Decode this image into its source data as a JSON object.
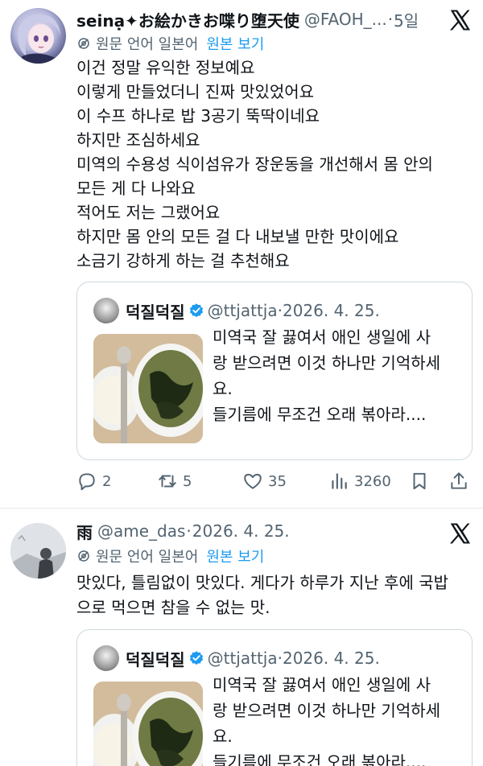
{
  "tweets": [
    {
      "name": "seinạ✦お絵かきお喋り堕天使",
      "handle": "@FAOH_...",
      "separator": "·",
      "time": "5일",
      "translate_label": "원문 언어 일본어",
      "translate_link": "원본 보기",
      "body": [
        "이건 정말 유익한 정보예요",
        "이렇게 만들었더니 진짜 맛있었어요",
        "이 수프 하나로 밥 3공기 뚝딱이네요",
        "하지만 조심하세요",
        "미역의 수용성 식이섬유가 장운동을 개선해서 몸 안의",
        "모든 게 다 나와요",
        "적어도 저는 그랬어요",
        "하지만 몸 안의 모든 걸 다 내보낼 만한 맛이에요",
        "소금기 강하게 하는 걸 추천해요"
      ],
      "quote": {
        "name": "덕질덕질",
        "handle": "@ttjattja",
        "separator": "·",
        "time": "2026. 4. 25.",
        "text": [
          "미역국 잘 끓여서 애인 생일에 사",
          "랑 받으려면 이것 하나만 기억하세",
          "요.",
          "들기름에 무조건 오래 볶아라...."
        ]
      },
      "actions": {
        "reply_count": "2",
        "retweet_count": "5",
        "like_count": "35",
        "view_count": "3260"
      }
    },
    {
      "name": "雨",
      "handle": "@ame_das",
      "separator": "·",
      "time": "2026. 4. 25.",
      "translate_label": "원문 언어 일본어",
      "translate_link": "원본 보기",
      "body": [
        "맛있다, 틀림없이 맛있다. 게다가 하루가 지난 후에 국밥",
        "으로 먹으면 참을 수 없는 맛."
      ],
      "quote": {
        "name": "덕질덕질",
        "handle": "@ttjattja",
        "separator": "·",
        "time": "2026. 4. 25.",
        "text": [
          "미역국 잘 끓여서 애인 생일에 사",
          "랑 받으려면 이것 하나만 기억하세",
          "요.",
          "들기름에 무조건 오래 볶아라...."
        ]
      }
    }
  ],
  "icons": {
    "platform_logo": "x-logo-icon",
    "translate": "gear-icon",
    "verified": "verified-badge-icon",
    "reply": "reply-icon",
    "retweet": "retweet-icon",
    "like": "heart-icon",
    "views": "views-icon",
    "bookmark": "bookmark-icon",
    "share": "share-icon"
  },
  "colors": {
    "link": "#1d9bf0",
    "secondary_text": "#536471",
    "primary_text": "#0f1419",
    "border": "#cfd9de"
  }
}
